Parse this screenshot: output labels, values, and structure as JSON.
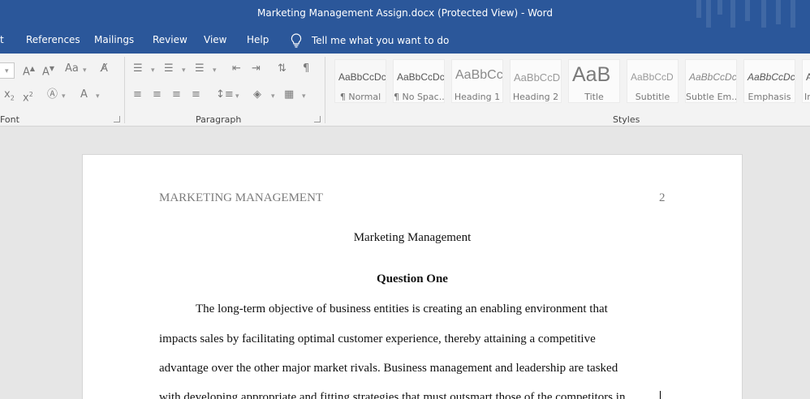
{
  "window": {
    "title": "Marketing Management Assign.docx (Protected View)  -  Word"
  },
  "menu": {
    "tabs": [
      "t",
      "References",
      "Mailings",
      "Review",
      "View",
      "Help"
    ],
    "tell_me": "Tell me what you want to do"
  },
  "ribbon": {
    "groups": {
      "font": "Font",
      "paragraph": "Paragraph",
      "styles": "Styles"
    },
    "styles": [
      {
        "sample": "AaBbCcDc",
        "name": "¶ Normal"
      },
      {
        "sample": "AaBbCcDc",
        "name": "¶ No Spac..."
      },
      {
        "sample": "AaBbCc",
        "name": "Heading 1"
      },
      {
        "sample": "AaBbCcD",
        "name": "Heading 2"
      },
      {
        "sample": "AaB",
        "name": "Title"
      },
      {
        "sample": "AaBbCcD",
        "name": "Subtitle"
      },
      {
        "sample": "AaBbCcDc",
        "name": "Subtle Em..."
      },
      {
        "sample": "AaBbCcDc",
        "name": "Emphasis"
      },
      {
        "sample": "A",
        "name": "In"
      }
    ]
  },
  "document": {
    "header_left": "MARKETING MANAGEMENT",
    "header_page_number": "2",
    "title": "Marketing Management",
    "heading": "Question One",
    "paragraph_lines": [
      "The long-term objective of business entities is creating an enabling environment that",
      "impacts sales by facilitating optimal customer experience, thereby attaining a competitive",
      "advantage over the other major market rivals. Business management and leadership are tasked",
      "with developing appropriate and fitting strategies that must outsmart those of the competitors in"
    ]
  }
}
